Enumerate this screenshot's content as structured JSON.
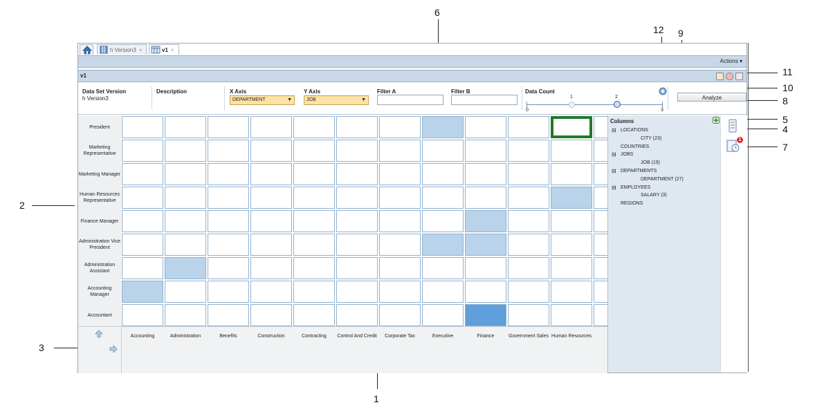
{
  "tabs": [
    {
      "label": "",
      "icon": "home-icon"
    },
    {
      "label": "h Version3",
      "icon": "cube-icon",
      "close": "×"
    },
    {
      "label": "v1",
      "icon": "grid-icon",
      "close": "×"
    }
  ],
  "actions_label": "Actions ▾",
  "view_title": "v1",
  "filters": {
    "data_set_version_label": "Data Set Version",
    "data_set_version_value": "h Version3",
    "description_label": "Description",
    "x_axis_label": "X Axis",
    "x_axis_value": "DEPARTMENT",
    "y_axis_label": "Y Axis",
    "y_axis_value": "JOB",
    "filter_a_label": "Filter A",
    "filter_b_label": "Filter B",
    "data_count_label": "Data Count",
    "slider_ticks": [
      "0",
      "1",
      "2",
      "3"
    ],
    "slider_value": 2,
    "analyze_label": "Analyze"
  },
  "rows": [
    "President",
    "Marketing Representative",
    "Marketing Manager",
    "Human Resources Representative",
    "Finance Manager",
    "Administration Vice President",
    "Administration Assistant",
    "Accounting Manager",
    "Accountant"
  ],
  "columns": [
    "Accounting",
    "Administration",
    "Benefits",
    "Construction",
    "Contracting",
    "Control And Credit",
    "Corporate Tax",
    "Executive",
    "Finance",
    "Government Sales",
    "Human Resources"
  ],
  "highlights": [
    {
      "row": 0,
      "col": 7,
      "level": "light"
    },
    {
      "row": 0,
      "col": 10,
      "level": "selected"
    },
    {
      "row": 3,
      "col": 10,
      "level": "light"
    },
    {
      "row": 4,
      "col": 8,
      "level": "light"
    },
    {
      "row": 5,
      "col": 7,
      "level": "light"
    },
    {
      "row": 5,
      "col": 8,
      "level": "light"
    },
    {
      "row": 6,
      "col": 1,
      "level": "light"
    },
    {
      "row": 7,
      "col": 0,
      "level": "light"
    },
    {
      "row": 8,
      "col": 8,
      "level": "dark"
    }
  ],
  "columns_panel": {
    "title": "Columns",
    "tree": [
      {
        "label": "LOCATIONS",
        "expanded": true,
        "level": 0
      },
      {
        "label": "CITY (23)",
        "level": 2
      },
      {
        "label": "COUNTRIES",
        "level": 1
      },
      {
        "label": "JOBS",
        "expanded": true,
        "level": 0
      },
      {
        "label": "JOB (19)",
        "level": 2
      },
      {
        "label": "DEPARTMENTS",
        "expanded": true,
        "level": 0
      },
      {
        "label": "DEPARTMENT (27)",
        "level": 2
      },
      {
        "label": "EMPLOYEES",
        "expanded": true,
        "level": 0
      },
      {
        "label": "SALARY (3)",
        "level": 2
      },
      {
        "label": "REGIONS",
        "level": 1
      }
    ]
  },
  "sidebar": {
    "notification_badge": "1"
  },
  "callouts": [
    "1",
    "2",
    "3",
    "4",
    "5",
    "6",
    "7",
    "8",
    "9",
    "10",
    "11",
    "12"
  ],
  "colors": {
    "light_cell": "#b9d3ea",
    "dark_cell": "#5e9fdc",
    "selected_border": "#1f7a2a",
    "toolbar_bg": "#c8d8e8"
  }
}
